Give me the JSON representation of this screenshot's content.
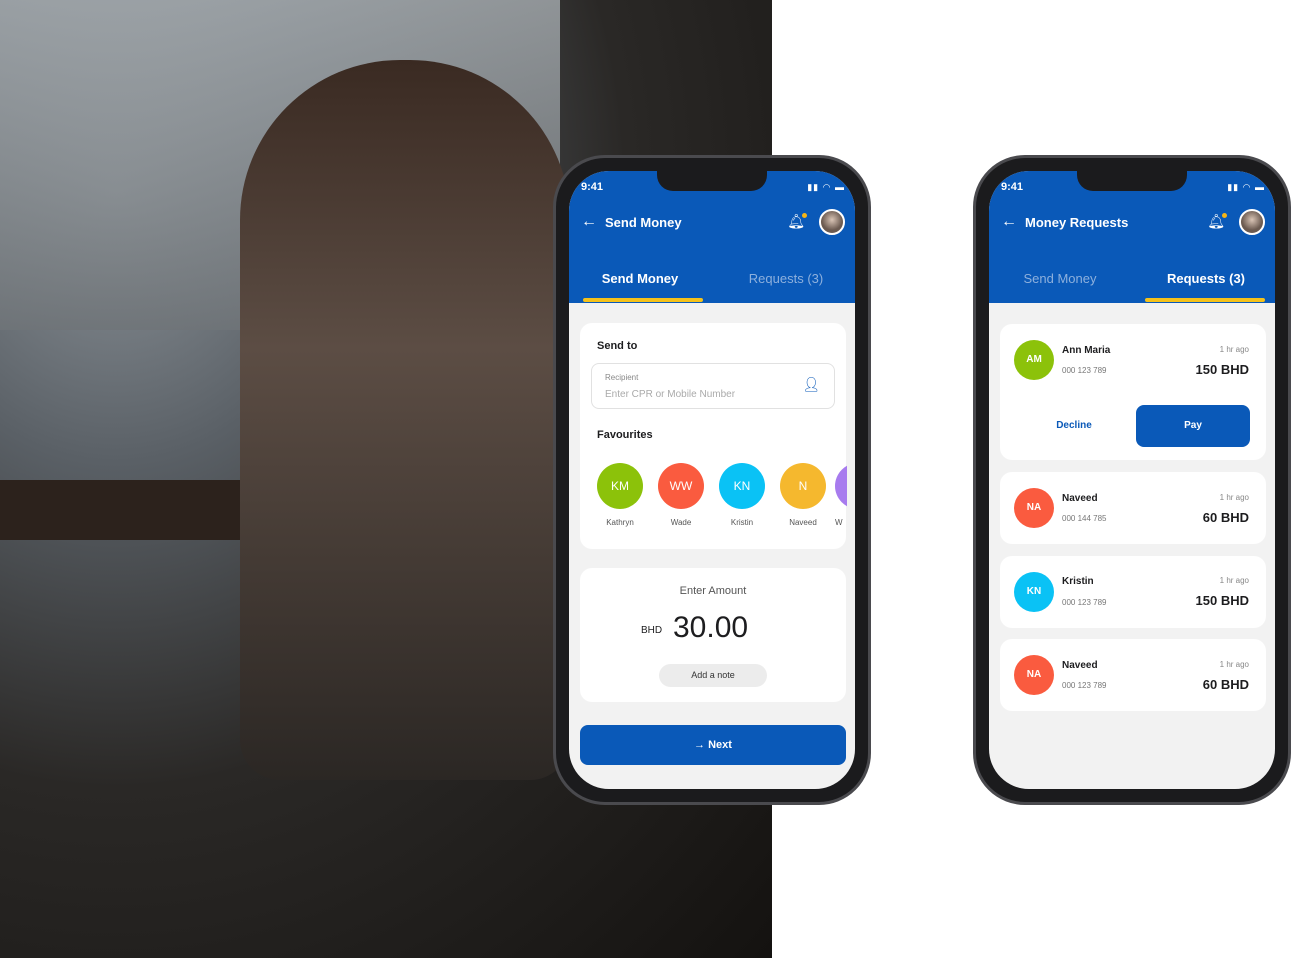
{
  "status": {
    "time": "9:41",
    "icons": "signal-wifi-battery"
  },
  "send": {
    "title": "Send Money",
    "tabs": [
      {
        "label": "Send Money",
        "active": true
      },
      {
        "label": "Requests (3)",
        "active": false
      }
    ],
    "send_to": "Send to",
    "recipient_label": "Recipient",
    "recipient_placeholder": "Enter CPR or Mobile Number",
    "favourites_title": "Favourites",
    "favourites": [
      {
        "initials": "KM",
        "name": "Kathryn",
        "color": "#8cc20a"
      },
      {
        "initials": "WW",
        "name": "Wade",
        "color": "#fa5b3f"
      },
      {
        "initials": "KN",
        "name": "Kristin",
        "color": "#0ac2f5"
      },
      {
        "initials": "N",
        "name": "Naveed",
        "color": "#f5b82e"
      },
      {
        "initials": "",
        "name": "W",
        "color": "#a77bee"
      }
    ],
    "amount_label": "Enter Amount",
    "currency": "BHD",
    "amount": "30.00",
    "note_button": "Add a note",
    "next_button": "Next"
  },
  "requests": {
    "title": "Money Requests",
    "tabs": [
      {
        "label": "Send Money",
        "active": false
      },
      {
        "label": "Requests (3)",
        "active": true
      }
    ],
    "decline": "Decline",
    "pay": "Pay",
    "items": [
      {
        "initials": "AM",
        "name": "Ann Maria",
        "phone": "000 123 789",
        "time": "1 hr ago",
        "amount": "150 BHD",
        "color": "#8cc20a"
      },
      {
        "initials": "NA",
        "name": "Naveed",
        "phone": "000 144 785",
        "time": "1 hr ago",
        "amount": "60 BHD",
        "color": "#fa5b3f"
      },
      {
        "initials": "KN",
        "name": "Kristin",
        "phone": "000 123 789",
        "time": "1 hr ago",
        "amount": "150 BHD",
        "color": "#0ac2f5"
      },
      {
        "initials": "NA",
        "name": "Naveed",
        "phone": "000 123 789",
        "time": "1 hr ago",
        "amount": "60 BHD",
        "color": "#fa5b3f"
      }
    ]
  },
  "colors": {
    "primary": "#0a59b8",
    "accent": "#f5c21b"
  }
}
